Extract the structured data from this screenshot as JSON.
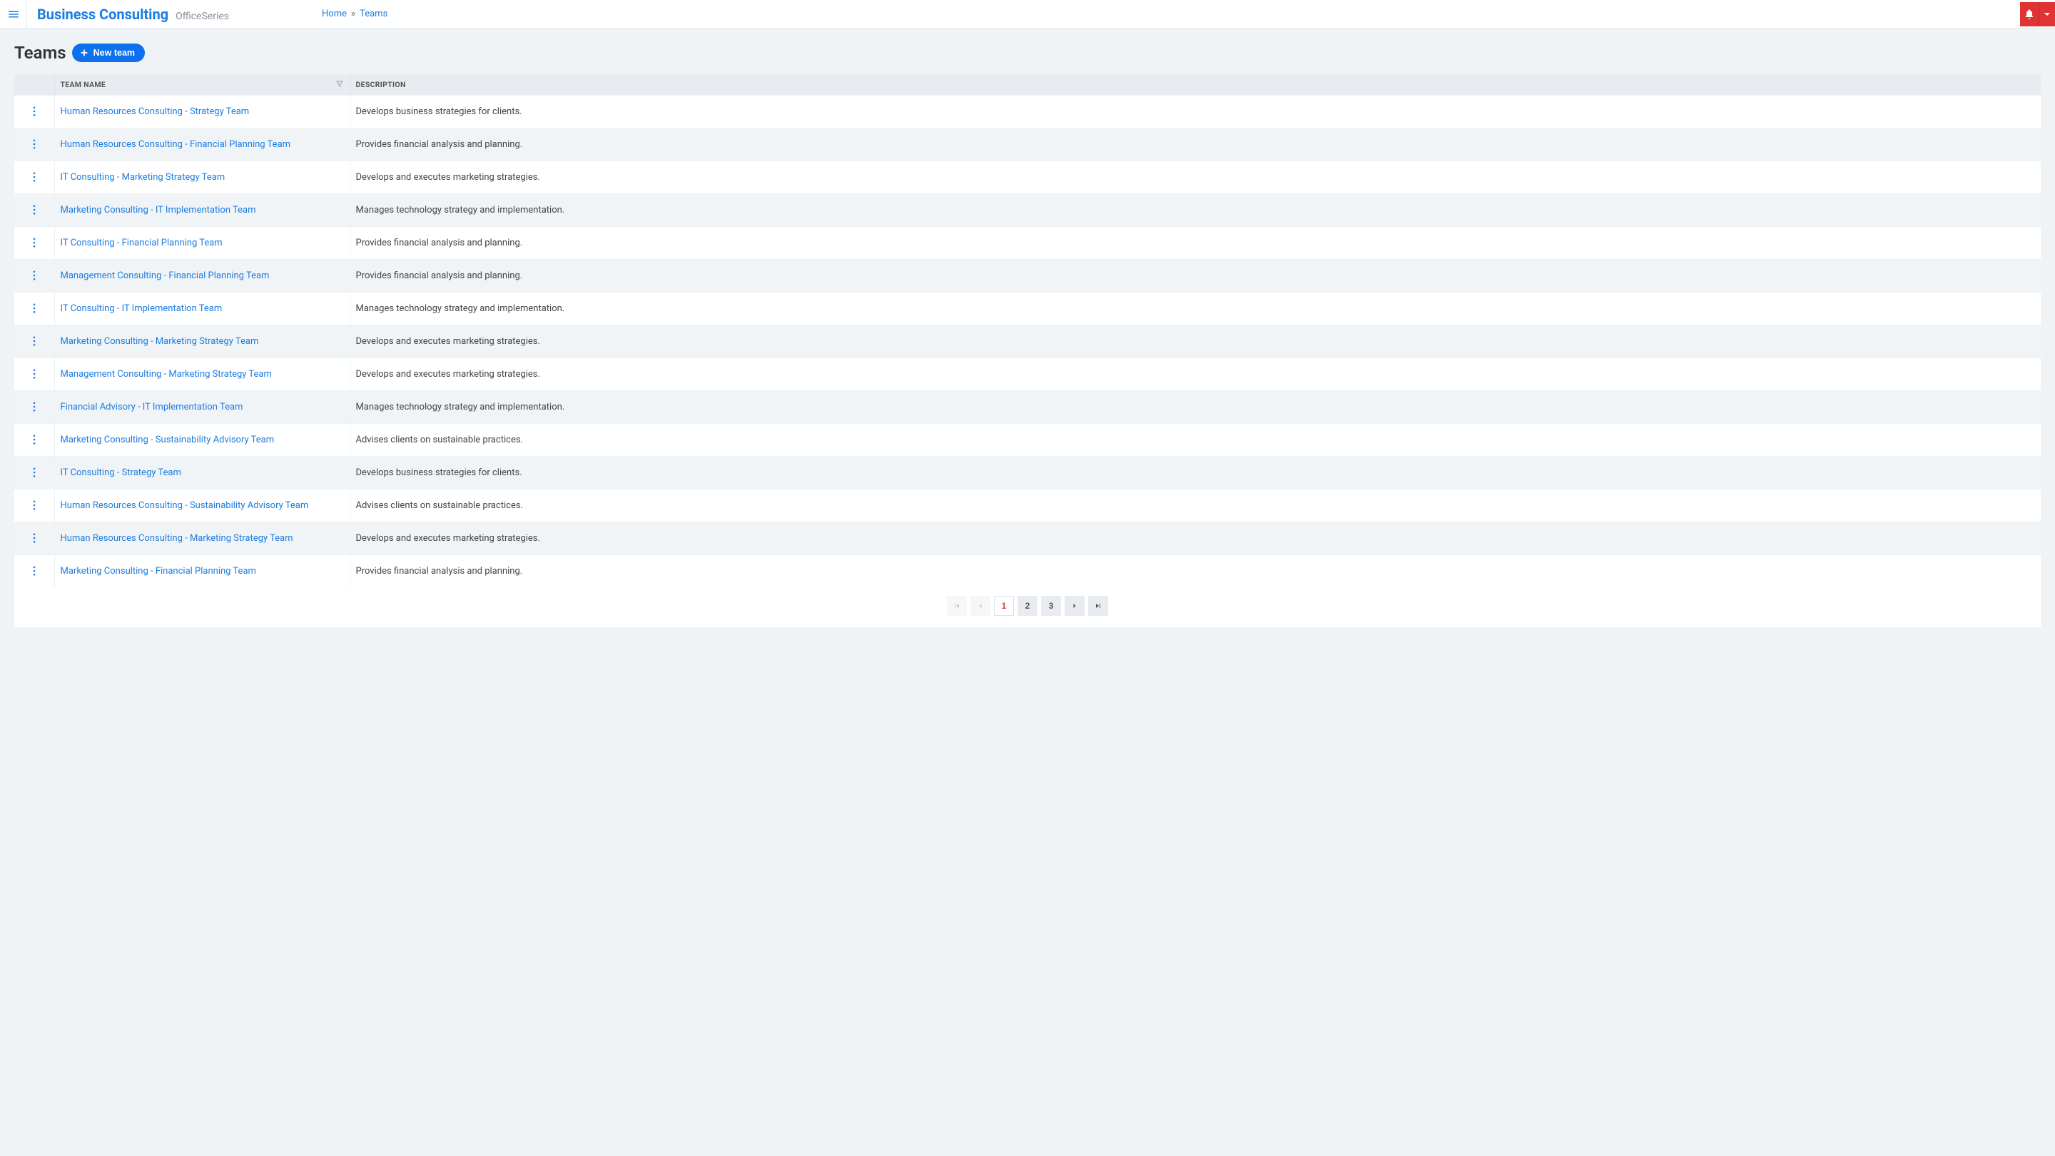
{
  "header": {
    "brand_name": "Business Consulting",
    "brand_suffix": "OfficeSeries"
  },
  "breadcrumb": {
    "home": "Home",
    "current": "Teams"
  },
  "page": {
    "title": "Teams",
    "new_button": "New team"
  },
  "table": {
    "columns": {
      "name": "Team Name",
      "description": "Description"
    },
    "rows": [
      {
        "name": "Human Resources Consulting - Strategy Team",
        "description": "Develops business strategies for clients."
      },
      {
        "name": "Human Resources Consulting - Financial Planning Team",
        "description": "Provides financial analysis and planning."
      },
      {
        "name": "IT Consulting - Marketing Strategy Team",
        "description": "Develops and executes marketing strategies."
      },
      {
        "name": "Marketing Consulting - IT Implementation Team",
        "description": "Manages technology strategy and implementation."
      },
      {
        "name": "IT Consulting - Financial Planning Team",
        "description": "Provides financial analysis and planning."
      },
      {
        "name": "Management Consulting - Financial Planning Team",
        "description": "Provides financial analysis and planning."
      },
      {
        "name": "IT Consulting - IT Implementation Team",
        "description": "Manages technology strategy and implementation."
      },
      {
        "name": "Marketing Consulting - Marketing Strategy Team",
        "description": "Develops and executes marketing strategies."
      },
      {
        "name": "Management Consulting - Marketing Strategy Team",
        "description": "Develops and executes marketing strategies."
      },
      {
        "name": "Financial Advisory - IT Implementation Team",
        "description": "Manages technology strategy and implementation."
      },
      {
        "name": "Marketing Consulting - Sustainability Advisory Team",
        "description": "Advises clients on sustainable practices."
      },
      {
        "name": "IT Consulting - Strategy Team",
        "description": "Develops business strategies for clients."
      },
      {
        "name": "Human Resources Consulting - Sustainability Advisory Team",
        "description": "Advises clients on sustainable practices."
      },
      {
        "name": "Human Resources Consulting - Marketing Strategy Team",
        "description": "Develops and executes marketing strategies."
      },
      {
        "name": "Marketing Consulting - Financial Planning Team",
        "description": "Provides financial analysis and planning."
      }
    ]
  },
  "pagination": {
    "pages": [
      "1",
      "2",
      "3"
    ],
    "current": "1"
  }
}
